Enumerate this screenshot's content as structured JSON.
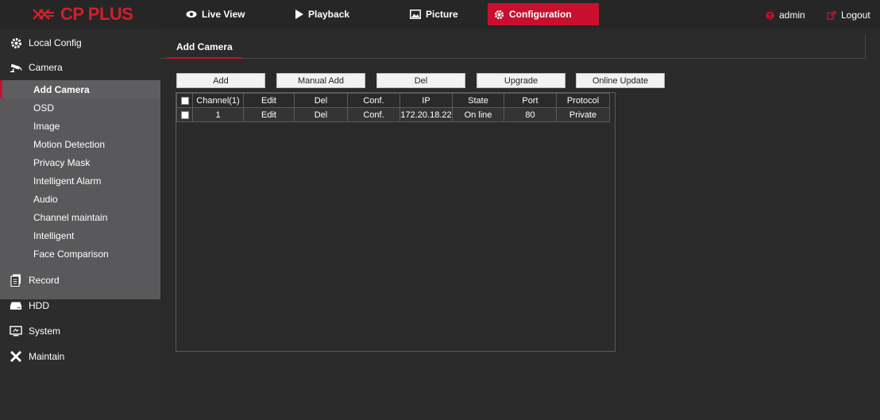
{
  "header": {
    "logo_text": "CP PLUS",
    "tabs": [
      {
        "label": "Live View",
        "icon": "eye-icon"
      },
      {
        "label": "Playback",
        "icon": "play-icon"
      },
      {
        "label": "Picture",
        "icon": "picture-icon"
      },
      {
        "label": "Configuration",
        "icon": "gear-icon",
        "active": true
      }
    ],
    "user": "admin",
    "logout": "Logout"
  },
  "sidebar": {
    "items": [
      {
        "label": "Local Config",
        "icon": "gear-icon"
      },
      {
        "label": "Camera",
        "icon": "camera-icon"
      },
      {
        "label": "Record",
        "icon": "record-icon"
      },
      {
        "label": "HDD",
        "icon": "hdd-icon"
      },
      {
        "label": "System",
        "icon": "system-icon"
      },
      {
        "label": "Maintain",
        "icon": "tools-icon"
      }
    ],
    "camera_sub": [
      "Add Camera",
      "OSD",
      "Image",
      "Motion Detection",
      "Privacy Mask",
      "Intelligent Alarm",
      "Audio",
      "Channel maintain",
      "Intelligent",
      "Face Comparison"
    ],
    "active_sub": "Add Camera"
  },
  "main": {
    "title": "Add Camera",
    "buttons": [
      "Add",
      "Manual Add",
      "Del",
      "Upgrade",
      "Online Update"
    ],
    "table": {
      "headers": [
        "Channel(1)",
        "Edit",
        "Del",
        "Conf.",
        "IP",
        "State",
        "Port",
        "Protocol"
      ],
      "rows": [
        {
          "channel": "1",
          "edit": "Edit",
          "del": "Del",
          "conf": "Conf.",
          "ip": "172.20.18.22",
          "state": "On line",
          "port": "80",
          "protocol": "Private"
        }
      ]
    }
  },
  "colors": {
    "accent": "#c8102e",
    "sidebar_sub": "#59595b",
    "background": "#2a2a2a"
  }
}
